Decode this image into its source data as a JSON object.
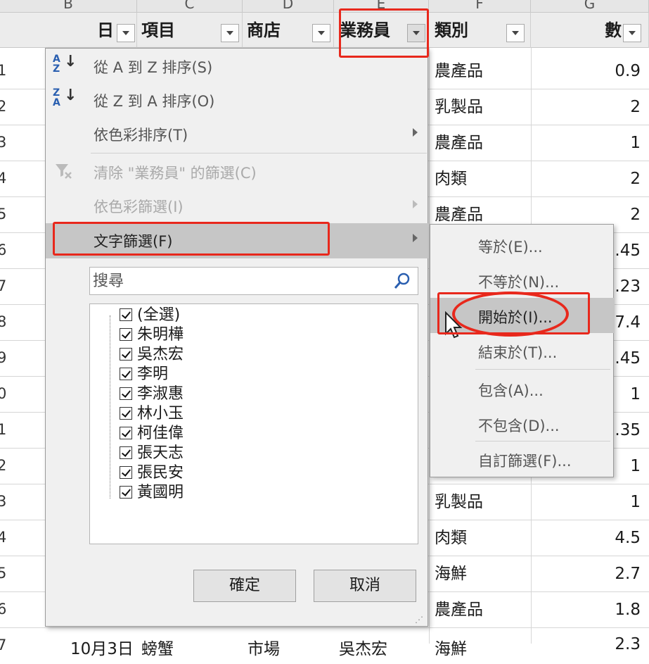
{
  "sheet": {
    "column_letters": [
      "B",
      "C",
      "D",
      "E",
      "F",
      "G"
    ],
    "headers": [
      "日",
      "項目",
      "商店",
      "業務員",
      "類別",
      "數"
    ],
    "row_numbers": [
      "1",
      "2",
      "3",
      "4",
      "5",
      "6",
      "7",
      "8",
      "9",
      "0",
      "1",
      "2",
      "3",
      "4",
      "5",
      "6",
      "7"
    ],
    "rows": [
      {
        "category": "農產品",
        "qty": "0.9"
      },
      {
        "category": "乳製品",
        "qty": "2"
      },
      {
        "category": "農產品",
        "qty": "1"
      },
      {
        "category": "肉類",
        "qty": "2"
      },
      {
        "category": "農產品",
        "qty": "2"
      },
      {
        "category": "",
        "qty": ".45"
      },
      {
        "category": "",
        "qty": ".23"
      },
      {
        "category": "",
        "qty": "7.4"
      },
      {
        "category": "",
        "qty": ".45"
      },
      {
        "category": "",
        "qty": "1"
      },
      {
        "category": "",
        "qty": ".35"
      },
      {
        "category": "",
        "qty": "1"
      },
      {
        "category": "乳製品",
        "qty": "1"
      },
      {
        "category": "肉類",
        "qty": "4.5"
      },
      {
        "category": "海鮮",
        "qty": "2.7"
      },
      {
        "category": "農產品",
        "qty": "1.8"
      }
    ],
    "partial_bottom_row": [
      "10月3日",
      "螃蟹",
      "市場",
      "吳杰宏",
      "海鮮",
      "2.3"
    ]
  },
  "filter_menu": {
    "sort_asc": "從 A 到 Z 排序(S)",
    "sort_desc": "從 Z 到 A 排序(O)",
    "sort_by_color": "依色彩排序(T)",
    "clear_filter": "清除 \"業務員\" 的篩選(C)",
    "filter_by_color": "依色彩篩選(I)",
    "text_filters": "文字篩選(F)",
    "search_placeholder": "搜尋",
    "list_items": [
      "(全選)",
      "朱明樺",
      "吳杰宏",
      "李明",
      "李淑惠",
      "林小玉",
      "柯佳偉",
      "張天志",
      "張民安",
      "黃國明"
    ],
    "ok": "確定",
    "cancel": "取消"
  },
  "text_filter_submenu": {
    "items": [
      "等於(E)...",
      "不等於(N)...",
      "開始於(I)...",
      "結束於(T)...",
      "包含(A)...",
      "不包含(D)...",
      "自訂篩選(F)..."
    ]
  },
  "colors": {
    "annotation_red": "#e8281c",
    "menu_bg": "#f0f0f0",
    "highlight_bg": "#c6c6c6"
  }
}
